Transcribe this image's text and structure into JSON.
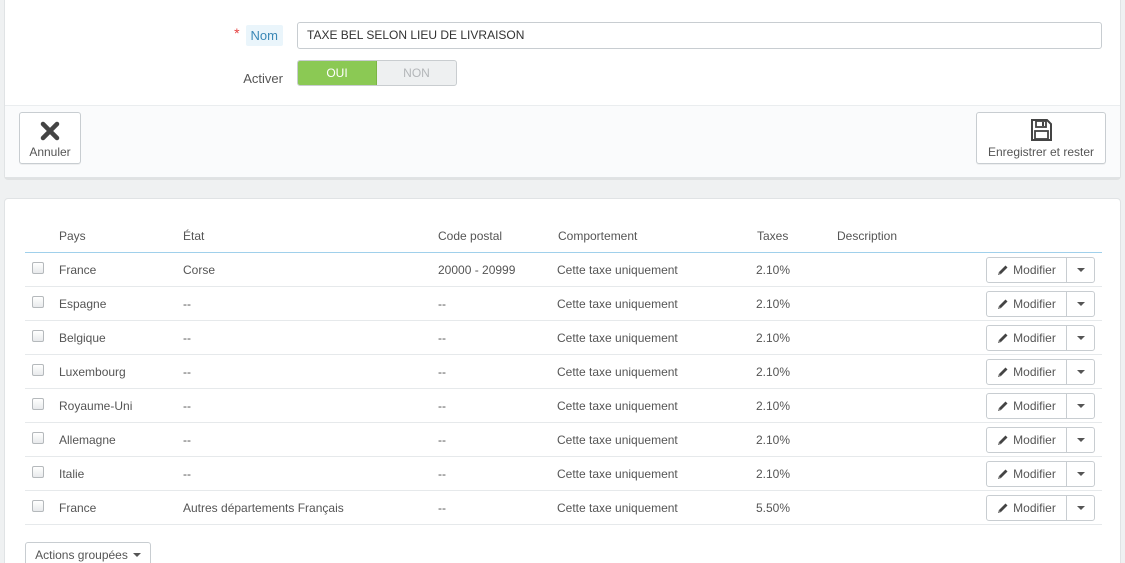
{
  "form": {
    "name_label": "Nom",
    "name_required_mark": "*",
    "name_value": "TAXE BEL SELON LIEU DE LIVRAISON",
    "activer_label": "Activer",
    "switch_on_label": "OUI",
    "switch_off_label": "NON",
    "switch_state": "on",
    "cancel_label": "Annuler",
    "save_label": "Enregistrer et rester"
  },
  "table": {
    "headers": [
      "Pays",
      "État",
      "Code postal",
      "Comportement",
      "Taxes",
      "Description"
    ],
    "edit_label": "Modifier",
    "rows": [
      {
        "pays": "France",
        "etat": "Corse",
        "code_postal": "20000 - 20999",
        "comportement": "Cette taxe uniquement",
        "taxes": "2.10%",
        "description": ""
      },
      {
        "pays": "Espagne",
        "etat": "--",
        "code_postal": "--",
        "comportement": "Cette taxe uniquement",
        "taxes": "2.10%",
        "description": ""
      },
      {
        "pays": "Belgique",
        "etat": "--",
        "code_postal": "--",
        "comportement": "Cette taxe uniquement",
        "taxes": "2.10%",
        "description": ""
      },
      {
        "pays": "Luxembourg",
        "etat": "--",
        "code_postal": "--",
        "comportement": "Cette taxe uniquement",
        "taxes": "2.10%",
        "description": ""
      },
      {
        "pays": "Royaume-Uni",
        "etat": "--",
        "code_postal": "--",
        "comportement": "Cette taxe uniquement",
        "taxes": "2.10%",
        "description": ""
      },
      {
        "pays": "Allemagne",
        "etat": "--",
        "code_postal": "--",
        "comportement": "Cette taxe uniquement",
        "taxes": "2.10%",
        "description": ""
      },
      {
        "pays": "Italie",
        "etat": "--",
        "code_postal": "--",
        "comportement": "Cette taxe uniquement",
        "taxes": "2.10%",
        "description": ""
      },
      {
        "pays": "France",
        "etat": "Autres départements Français",
        "code_postal": "--",
        "comportement": "Cette taxe uniquement",
        "taxes": "5.50%",
        "description": ""
      }
    ]
  },
  "bulk_actions_label": "Actions groupées",
  "colors": {
    "switch_on": "#8bc954",
    "label_tag_bg": "#eaf5fb",
    "label_tag_text": "#3b88b6",
    "required": "#e54040",
    "header_border": "#a0d0eb"
  }
}
